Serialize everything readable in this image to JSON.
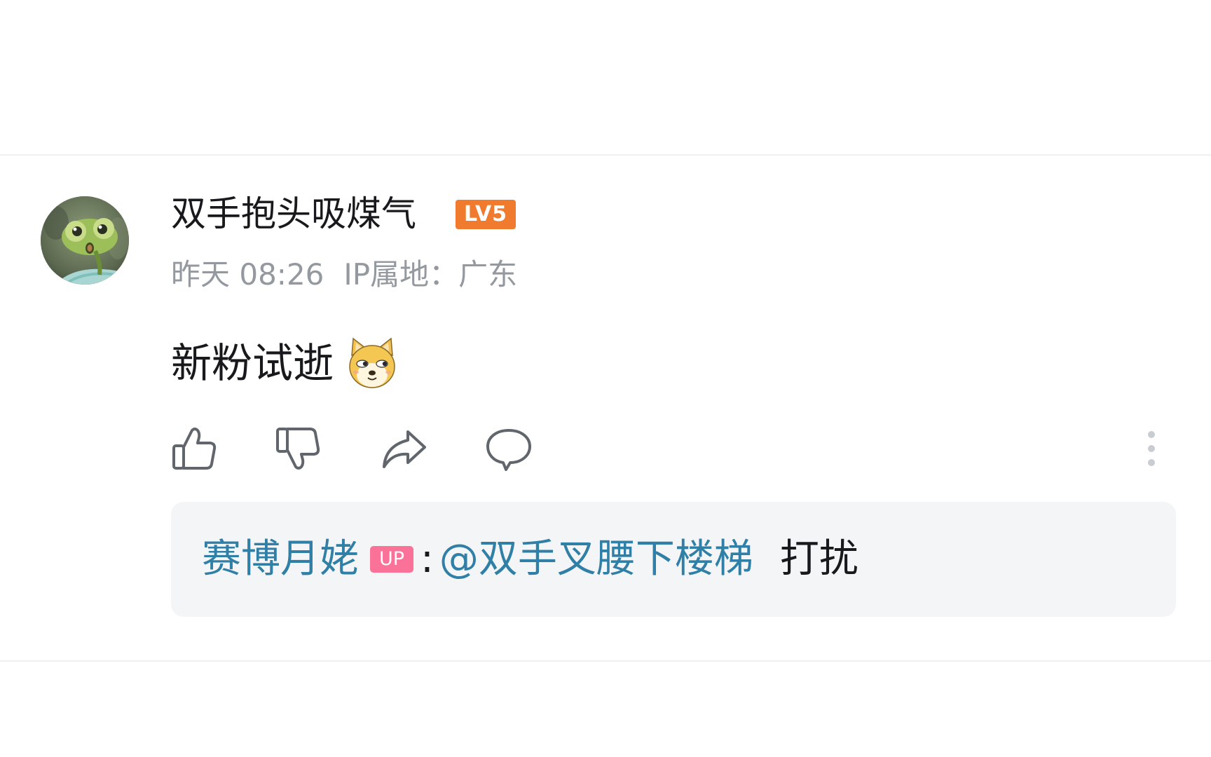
{
  "comment": {
    "username": "双手抱头吸煤气",
    "level_badge": "LV5",
    "time": "昨天 08:26",
    "ip_location": "IP属地：广东",
    "text": "新粉试逝",
    "emoji_name": "doge-emoji",
    "actions": {
      "like_icon": "thumbs-up-icon",
      "dislike_icon": "thumbs-down-icon",
      "share_icon": "share-arrow-icon",
      "reply_icon": "speech-bubble-icon",
      "more_icon": "vertical-dots-icon"
    }
  },
  "reply": {
    "author": "赛博月姥",
    "badge": "UP",
    "colon": ":",
    "mention": "@双手叉腰下楼梯",
    "text": "打扰"
  },
  "colors": {
    "username": "#18191c",
    "meta": "#9499a0",
    "level_badge": "#f07a2d",
    "link": "#2f7fa6",
    "up_badge": "#fb7299",
    "reply_box": "#f4f5f7",
    "icon": "#61666d"
  }
}
